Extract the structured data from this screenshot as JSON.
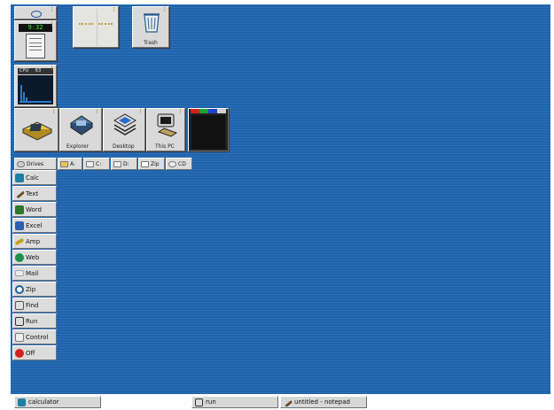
{
  "desktop": {
    "trash_label": "Trash"
  },
  "dock": {
    "clock_time": "9:32",
    "monitor_label_a": "CPU",
    "monitor_label_b": "63"
  },
  "launch_bar": {
    "items": [
      {
        "label": ""
      },
      {
        "label": "Explorer"
      },
      {
        "label": "Desktop"
      },
      {
        "label": "This PC"
      }
    ]
  },
  "drives_bar": {
    "label": "Drives",
    "drives": [
      "A:",
      "C:",
      "D:",
      "Zip",
      "CD"
    ]
  },
  "menu": {
    "items": [
      {
        "label": "Calc",
        "icon": "calculator-icon",
        "color": "#1d7fa6"
      },
      {
        "label": "Text",
        "icon": "pencil-icon",
        "color": "#6b4a2a"
      },
      {
        "label": "Word",
        "icon": "word-icon",
        "color": "#2a7a2a"
      },
      {
        "label": "Excel",
        "icon": "excel-icon",
        "color": "#2b5fb0"
      },
      {
        "label": "Amp",
        "icon": "amp-icon",
        "color": "#c8a020"
      },
      {
        "label": "Web",
        "icon": "globe-icon",
        "color": "#1f8f4a"
      },
      {
        "label": "Mail",
        "icon": "mail-icon",
        "color": "#9aa7b8"
      },
      {
        "label": "Zip",
        "icon": "zip-icon",
        "color": "#1b5fa0"
      },
      {
        "label": "Find",
        "icon": "find-icon",
        "color": "#555555"
      },
      {
        "label": "Run",
        "icon": "run-icon",
        "color": "#333333"
      },
      {
        "label": "Control",
        "icon": "control-icon",
        "color": "#777777"
      },
      {
        "label": "Off",
        "icon": "power-icon",
        "color": "#d42020"
      }
    ]
  },
  "taskbar": {
    "tasks": [
      {
        "label": "calculator"
      },
      {
        "label": "run"
      },
      {
        "label": "untitled - notepad"
      }
    ]
  },
  "colors": {
    "desktop": "#1e63ad",
    "panel": "#d9d9d9"
  }
}
